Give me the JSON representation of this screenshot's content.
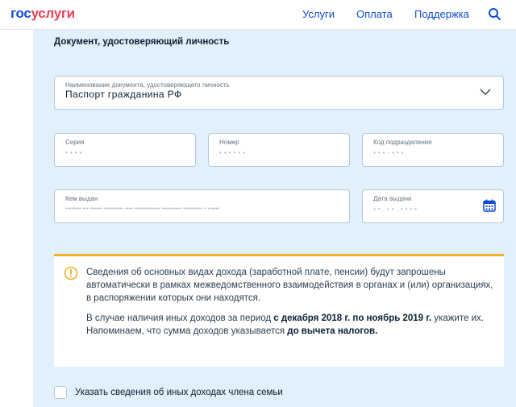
{
  "header": {
    "logo_part1": "гос",
    "logo_part2": "услуги",
    "nav": [
      "Услуги",
      "Оплата",
      "Поддержка"
    ],
    "search_icon": "search-icon"
  },
  "section": {
    "title": "Документ, удостоверяющий личность"
  },
  "document_type": {
    "label": "Наименование документа, удостоверяющего личность",
    "value": "Паспорт гражданина РФ"
  },
  "series": {
    "label": "Серия",
    "value": "• • • •"
  },
  "number": {
    "label": "Номер",
    "value": "• • • • • •"
  },
  "division_code": {
    "label": "Код подразделения",
    "value": "• • • - • • •"
  },
  "issued_by": {
    "label": "Кем выдан",
    "value": "•••••••• ••• •••••• •••••••••• •••• ••••••••••••• •••••••••• •••••••••• • ••••••"
  },
  "issue_date": {
    "label": "Дата выдачи",
    "value": "• • . • • . • • • •"
  },
  "info": {
    "icon": "exclamation-circle-icon",
    "accent_color": "#f2b123",
    "p1": "Сведения об основных видах дохода (заработной плате, пенсии) будут запрошены автоматически в рамках межведомственного взаимодействия в органах и (или) организациях, в распоряжении которых они находятся.",
    "p2_before": "В случае наличия иных доходов за период ",
    "p2_bold": "с декабря 2018 г. по ноябрь 2019 г.",
    "p2_after": " укажите их.",
    "p3_before": "Напоминаем, что сумма доходов указывается ",
    "p3_bold": "до вычета налогов."
  },
  "checkbox": {
    "label": "Указать сведения об иных доходах члена семьи",
    "checked": false
  }
}
